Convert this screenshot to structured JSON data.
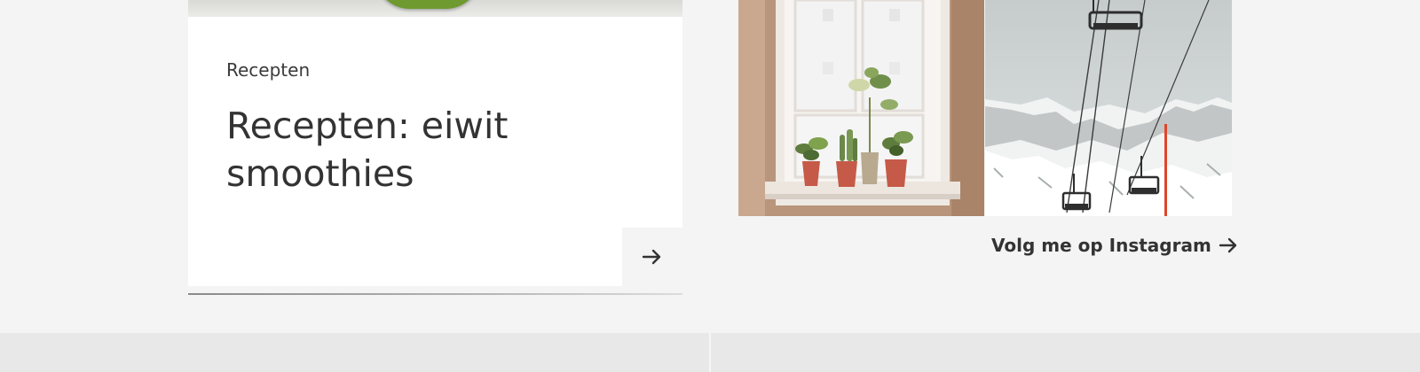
{
  "article_card": {
    "category": "Recepten",
    "title": "Recepten: eiwit smoothies",
    "arrow_icon": "arrow-right-icon"
  },
  "instagram": {
    "photos": [
      {
        "subject": "window-plants-photo"
      },
      {
        "subject": "ski-lift-photo"
      }
    ],
    "link_label": "Volg me op Instagram",
    "link_icon": "arrow-right-icon"
  },
  "colors": {
    "page_background": "#f4f4f4",
    "card_background": "#ffffff",
    "text": "#333333",
    "footer_background": "#e8e8e8",
    "ski_marker": "#e0452a"
  }
}
